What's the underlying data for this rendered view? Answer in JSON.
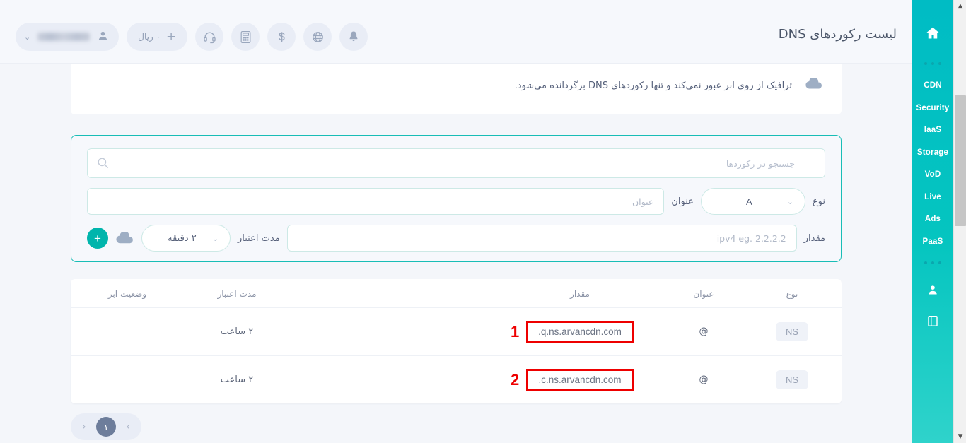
{
  "header": {
    "title": "لیست رکوردهای DNS",
    "user_chip": {
      "name_masked": "",
      "icon": "user-icon",
      "chevron": "⌄"
    },
    "balance_chip": {
      "label": "۰ ریال",
      "plus": "+"
    },
    "icons": [
      {
        "name": "headset-icon"
      },
      {
        "name": "calculator-icon"
      },
      {
        "name": "dollar-icon"
      },
      {
        "name": "globe-icon"
      },
      {
        "name": "bell-icon"
      }
    ]
  },
  "sidebar": {
    "home_icon": "home-icon",
    "items": [
      {
        "label": "CDN"
      },
      {
        "label": "Security"
      },
      {
        "label": "IaaS"
      },
      {
        "label": "Storage"
      },
      {
        "label": "VoD"
      },
      {
        "label": "Live"
      },
      {
        "label": "Ads"
      },
      {
        "label": "PaaS"
      }
    ],
    "bottom_icons": [
      {
        "name": "user-account-icon"
      },
      {
        "name": "docs-book-icon"
      }
    ]
  },
  "notice": {
    "row_top_cut": "",
    "row_text": "ترافیک از روی ابر عبور نمی‌کند و تنها رکوردهای DNS برگردانده می‌شود.",
    "cloud_icon_teal": "cloud-icon-teal",
    "cloud_icon_grey": "cloud-icon-grey"
  },
  "form": {
    "search_placeholder": "جستجو در رکوردها",
    "search_value": "",
    "search_icon": "search-icon",
    "type_label": "نوع",
    "type_value": "A",
    "title_label": "عنوان",
    "title_placeholder": "عنوان",
    "title_value": "",
    "value_label": "مقدار",
    "value_placeholder": "ipv4 eg. 2.2.2.2",
    "value_value": "",
    "ttl_label": "مدت اعتبار",
    "ttl_value": "۲ دقیقه",
    "cloud_toggle_icon": "cloud-icon",
    "add_button_label": "+"
  },
  "table": {
    "columns": {
      "type": "نوع",
      "title": "عنوان",
      "value": "مقدار",
      "ttl": "مدت اعتبار",
      "cloud_status": "وضعیت ابر"
    },
    "rows": [
      {
        "annotation": "1",
        "type": "NS",
        "title": "@",
        "value": "q.ns.arvancdn.com.",
        "ttl": "۲ ساعت",
        "cloud_status": ""
      },
      {
        "annotation": "2",
        "type": "NS",
        "title": "@",
        "value": "c.ns.arvancdn.com.",
        "ttl": "۲ ساعت",
        "cloud_status": ""
      }
    ]
  },
  "pagination": {
    "prev": "‹",
    "next": "›",
    "current_page": "۱"
  },
  "colors": {
    "brand_teal": "#00bcc4",
    "accent_teal": "#00b5ac",
    "annotation_red": "#ee0000",
    "page_bg": "#f4f6fa",
    "badge_bg": "#eff2f8"
  }
}
